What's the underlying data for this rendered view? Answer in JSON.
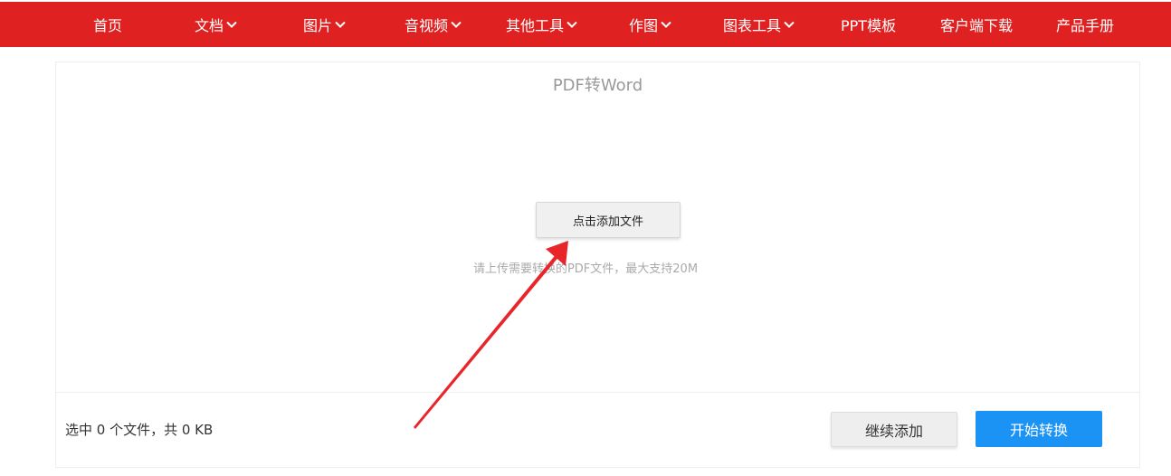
{
  "nav": {
    "items": [
      {
        "label": "首页",
        "has_dropdown": false
      },
      {
        "label": "文档",
        "has_dropdown": true
      },
      {
        "label": "图片",
        "has_dropdown": true
      },
      {
        "label": "音视频",
        "has_dropdown": true
      },
      {
        "label": "其他工具",
        "has_dropdown": true
      },
      {
        "label": "作图",
        "has_dropdown": true
      },
      {
        "label": "图表工具",
        "has_dropdown": true
      },
      {
        "label": "PPT模板",
        "has_dropdown": false
      },
      {
        "label": "客户端下载",
        "has_dropdown": false
      },
      {
        "label": "产品手册",
        "has_dropdown": false
      }
    ],
    "background_color": "#e02121",
    "dropdown_icon": "chevron-down-icon"
  },
  "converter": {
    "title": "PDF转Word",
    "add_file_label": "点击添加文件",
    "hint": "请上传需要转换的PDF文件，最大支持20M"
  },
  "footer": {
    "status": "选中 0 个文件，共 0 KB",
    "continue_label": "继续添加",
    "start_label": "开始转换",
    "start_color": "#1a93f5"
  },
  "annotation": {
    "arrow_color": "#e8262a",
    "arrow_icon": "red-arrow-annotation"
  }
}
